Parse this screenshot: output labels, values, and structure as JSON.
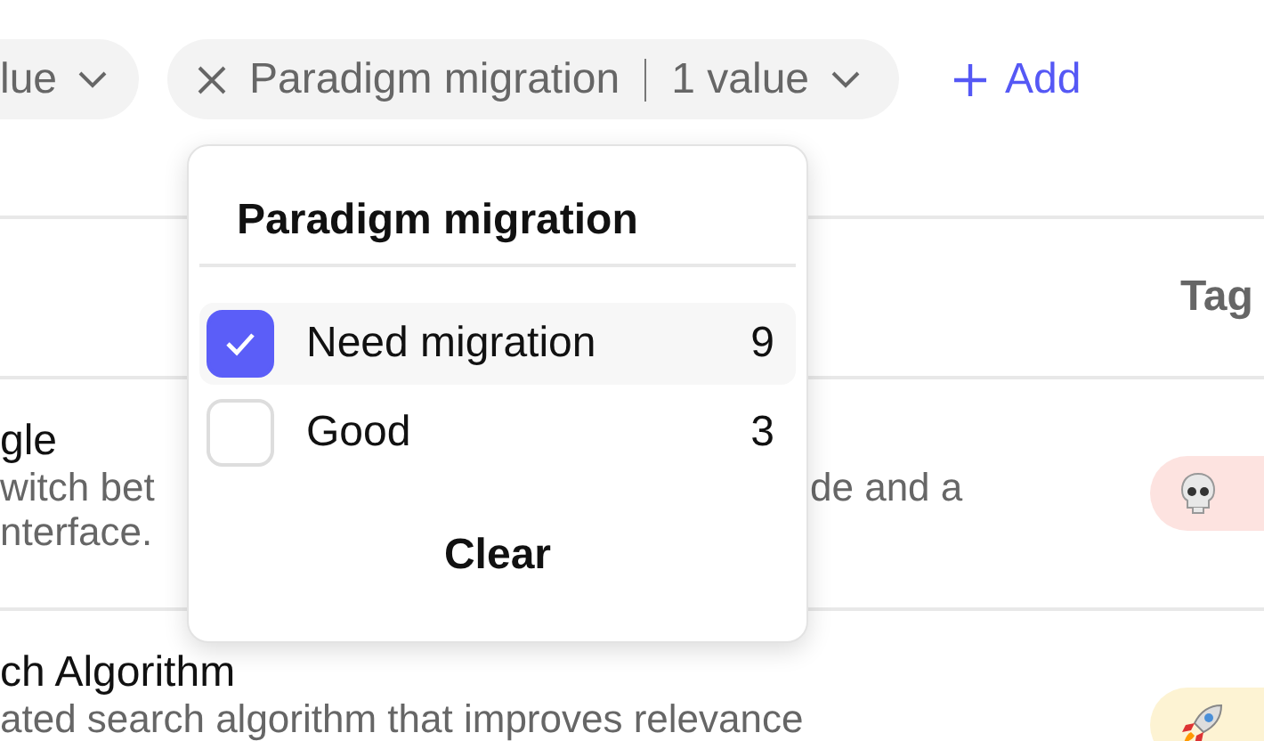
{
  "filters": [
    {
      "label": "lue",
      "removable": false
    },
    {
      "label": "Paradigm migration",
      "value": "1 value",
      "removable": true
    }
  ],
  "add_filter": "Add",
  "table": {
    "columns": [
      "Tag"
    ],
    "rows": [
      {
        "title": "gle",
        "lines": [
          [
            "witch bet",
            "de and a"
          ],
          [
            "nterface."
          ]
        ],
        "tag": {
          "kind": "skull",
          "color": "#fde3e0"
        }
      },
      {
        "title": "ch Algorithm",
        "lines": [
          [
            "ated search algorithm that improves relevance"
          ]
        ],
        "tag": {
          "kind": "rocket",
          "color": "#fdf3d3"
        }
      }
    ]
  },
  "popover": {
    "title": "Paradigm migration",
    "options": [
      {
        "label": "Need migration",
        "count": "9",
        "checked": true
      },
      {
        "label": "Good",
        "count": "3",
        "checked": false
      }
    ],
    "clear": "Clear"
  }
}
